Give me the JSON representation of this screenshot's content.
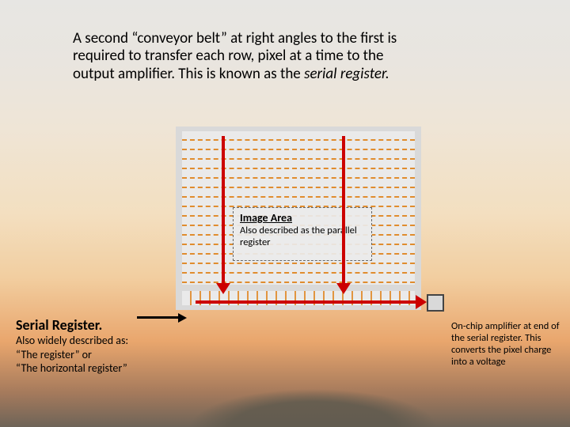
{
  "top_paragraph": {
    "line1": "A second “conveyor belt” at right angles to the first is",
    "line2": "required to transfer each row, pixel at a time to the",
    "line3_prefix": "output amplifier. This is known as the ",
    "line3_italic": "serial register."
  },
  "image_area": {
    "title": "Image Area",
    "subtitle": "Also described as the parallel register"
  },
  "serial_register": {
    "title": "Serial Register.",
    "also": "Also widely described as:",
    "alias1": "“The register” or",
    "alias2": "“The horizontal register”"
  },
  "amplifier_caption": "On-chip amplifier at end of the serial register. This converts the pixel charge into a voltage"
}
